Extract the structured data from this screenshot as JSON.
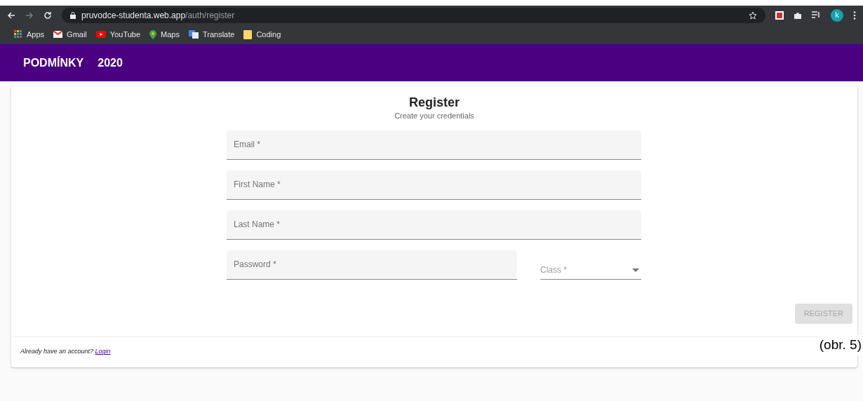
{
  "browser": {
    "url_host": "pruvodce-studenta.web.app",
    "url_path": "/auth/register",
    "avatar": "k",
    "bookmarks": [
      {
        "kind": "apps",
        "label": "Apps"
      },
      {
        "kind": "gmail",
        "label": "Gmail"
      },
      {
        "kind": "youtube",
        "label": "YouTube"
      },
      {
        "kind": "maps",
        "label": "Maps"
      },
      {
        "kind": "translate",
        "label": "Translate"
      },
      {
        "kind": "folder",
        "label": "Coding"
      }
    ]
  },
  "app_bar": {
    "title": "PODMÍNKY",
    "year": "2020"
  },
  "form": {
    "title": "Register",
    "subtitle": "Create your credentials",
    "fields": [
      {
        "kind": "text",
        "label": "Email *"
      },
      {
        "kind": "text",
        "label": "First Name *"
      },
      {
        "kind": "text",
        "label": "Last Name *"
      },
      {
        "kind": "text",
        "label": "Password *"
      },
      {
        "kind": "select",
        "label": "Class *"
      }
    ],
    "submit": {
      "label": "REGISTER",
      "disabled": true
    },
    "footer": {
      "prompt": "Already have an account?",
      "link": "Login"
    }
  },
  "caption": "(obr. 5)"
}
